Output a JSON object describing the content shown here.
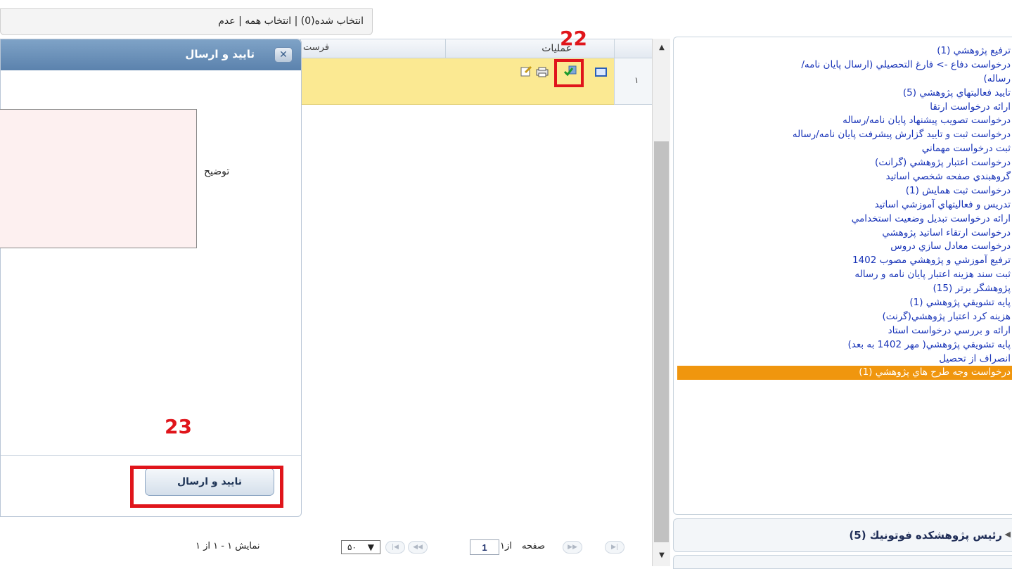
{
  "topbar": {
    "text": "انتخاب شده(0) | انتخاب همه | عدم"
  },
  "menu": {
    "items": [
      {
        "label": "ترفيع پژوهشي (1)"
      },
      {
        "label": "درخواست دفاع -> فارغ التحصيلي (ارسال پايان نامه/"
      },
      {
        "label": "رساله)"
      },
      {
        "label": "تاييد فعاليتهاي پژوهشي (5)"
      },
      {
        "label": "ارائه درخواست ارتقا"
      },
      {
        "label": "درخواست تصويب پيشنهاد پايان نامه/رساله"
      },
      {
        "label": "درخواست ثبت و تاييد گزارش پيشرفت پايان نامه/رساله"
      },
      {
        "label": "ثبت درخواست مهماني"
      },
      {
        "label": "درخواست اعتبار پژوهشي (گرانت)"
      },
      {
        "label": "گروهبندي صفحه شخصي اساتيد"
      },
      {
        "label": "درخواست ثبت همايش (1)"
      },
      {
        "label": "تدريس و فعاليتهاي آموزشي اساتيد"
      },
      {
        "label": "ارائه درخواست تبديل وضعيت استخدامي"
      },
      {
        "label": "درخواست ارتقاء اساتيد پژوهشي"
      },
      {
        "label": "درخواست معادل سازي دروس"
      },
      {
        "label": "ترفيع آموزشي و پژوهشي مصوب 1402"
      },
      {
        "label": "ثبت سند هزينه اعتبار پايان نامه و رساله"
      },
      {
        "label": "پژوهشگر برتر (15)"
      },
      {
        "label": "پايه تشويقي پژوهشي (1)"
      },
      {
        "label": "هزينه كرد اعتبار پژوهشي(گرنت)"
      },
      {
        "label": "ارائه و بررسي درخواست استاد"
      },
      {
        "label": "پايه تشويقي پژوهشي( مهر 1402 به بعد)"
      },
      {
        "label": "انصراف از تحصيل"
      },
      {
        "label": "درخواست وجه طرح هاي پژوهشي (1)"
      }
    ],
    "active_index": 23,
    "group_label": "رئيس پژوهشكده فوتونيك (5)"
  },
  "grid": {
    "col_ops": "عمليات",
    "col_send": "فرست",
    "row_number": "١"
  },
  "annotations": {
    "label_22": "22",
    "label_23": "23"
  },
  "dialog": {
    "title": "تاييد و ارسال",
    "close_glyph": "✕",
    "desc_label": "توضيح",
    "desc_value": "",
    "submit_label": "تاييد و ارسال"
  },
  "pager": {
    "page_label": "صفحه",
    "page_value": "1",
    "of_label": "از١",
    "info": "نمايش ١ - ١ از ١",
    "page_size": "۵۰"
  },
  "colors": {
    "accent": "#e0151b",
    "active_menu": "#f0960e",
    "link": "#1a35b8",
    "header": "#5b82ad",
    "row_highlight": "#fbe992"
  }
}
